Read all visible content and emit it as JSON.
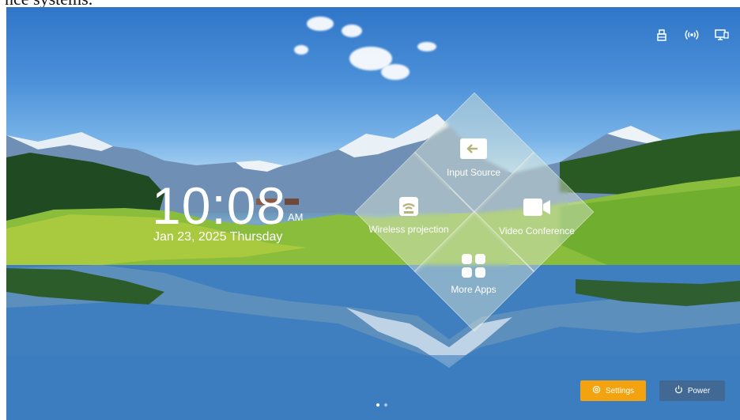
{
  "caption_fragment": "nce systems.",
  "status_icons": [
    {
      "name": "usb-icon"
    },
    {
      "name": "wireless-signal-icon"
    },
    {
      "name": "network-icon"
    }
  ],
  "clock": {
    "time": "10:08",
    "ampm": "AM",
    "date": "Jan 23, 2025  Thursday"
  },
  "tiles": {
    "input_source": {
      "label": "Input Source",
      "icon": "input-source-icon"
    },
    "wireless_projection": {
      "label": "Wireless projection",
      "icon": "wireless-projection-icon"
    },
    "video_conference": {
      "label": "Video Conference",
      "icon": "video-camera-icon"
    },
    "more_apps": {
      "label": "More Apps",
      "icon": "apps-grid-icon"
    }
  },
  "buttons": {
    "settings": {
      "label": "Settings",
      "icon": "settings-icon",
      "color": "#f2a30f"
    },
    "power": {
      "label": "Power",
      "icon": "power-icon"
    }
  },
  "pager": {
    "pages": 2,
    "active": 1
  }
}
